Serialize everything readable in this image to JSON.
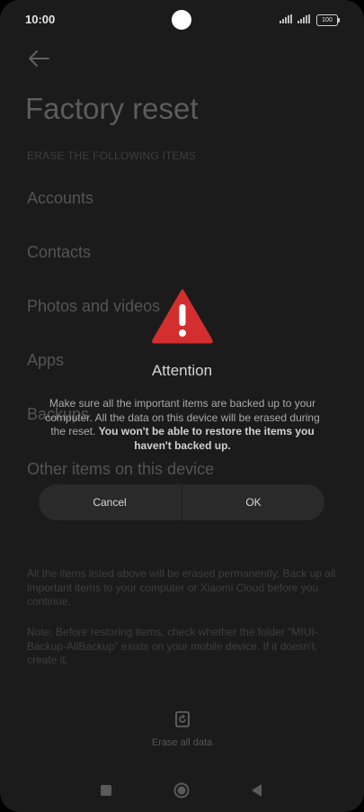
{
  "status": {
    "time": "10:00",
    "battery": "100"
  },
  "page": {
    "title": "Factory reset",
    "section_header": "ERASE THE FOLLOWING ITEMS",
    "items": [
      "Accounts",
      "Contacts",
      "Photos and videos",
      "Apps",
      "Backups",
      "Other items on this device"
    ],
    "info": "All the items listed above will be erased permanently. Back up all important items to your computer or Xiaomi Cloud before you continue.",
    "note": "Note: Before restoring items, check whether the folder \"MIUI-Backup-AllBackup\" exists on your mobile device. If it doesn't, create it.",
    "erase_label": "Erase all data"
  },
  "dialog": {
    "title": "Attention",
    "message": "Make sure all the important items are backed up to your computer. All the data on this device will be erased during the reset.",
    "message_bold": "You won't be able to restore the items you haven't backed up.",
    "cancel": "Cancel",
    "ok": "OK"
  },
  "icons": {
    "back": "arrow-left-icon",
    "warning": "warning-triangle-icon",
    "erase": "reset-icon",
    "nav_recent": "square-icon",
    "nav_home": "circle-icon",
    "nav_back": "triangle-back-icon"
  },
  "colors": {
    "warning": "#d32f2f",
    "background": "#1b1b1b",
    "button_bg": "#2a2a2a"
  }
}
